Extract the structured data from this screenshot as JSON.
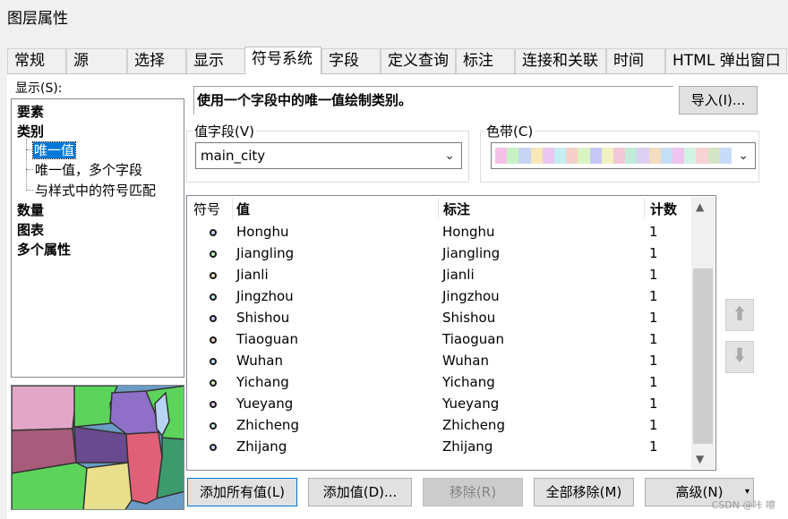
{
  "window": {
    "title": "图层属性"
  },
  "tabs": [
    {
      "label": "常规"
    },
    {
      "label": "源"
    },
    {
      "label": "选择"
    },
    {
      "label": "显示"
    },
    {
      "label": "符号系统"
    },
    {
      "label": "字段"
    },
    {
      "label": "定义查询"
    },
    {
      "label": "标注"
    },
    {
      "label": "连接和关联"
    },
    {
      "label": "时间"
    },
    {
      "label": "HTML 弹出窗口"
    }
  ],
  "show": {
    "label": "显示(S):",
    "tree": [
      {
        "label": "要素"
      },
      {
        "label": "类别"
      },
      {
        "label": "唯一值"
      },
      {
        "label": "唯一值，多个字段"
      },
      {
        "label": "与样式中的符号匹配"
      },
      {
        "label": "数量"
      },
      {
        "label": "图表"
      },
      {
        "label": "多个属性"
      }
    ]
  },
  "description": "使用一个字段中的唯一值绘制类别。",
  "import_button": "导入(I)...",
  "value_field": {
    "label": "值字段(V)",
    "value": "main_city"
  },
  "color_ramp": {
    "label": "色带(C)",
    "swatches": [
      "#f4c2e6",
      "#c6f2c4",
      "#c8d4f4",
      "#f6e6b8",
      "#e8c8f2",
      "#c4eef2",
      "#f4d0c8",
      "#d8f4c0",
      "#c8c8f6",
      "#f2f2c0",
      "#f2c8d8",
      "#c0ecd8",
      "#dcd0f4",
      "#f4dcc0",
      "#c4e0f4",
      "#f0c4f0",
      "#d0f4e4",
      "#f6d4d4",
      "#d4e4c4",
      "#c8dcf8"
    ]
  },
  "table": {
    "headers": {
      "symbol": "符号",
      "value": "值",
      "label": "标注",
      "count": "计数"
    },
    "rows": [
      {
        "value": "Honghu",
        "label": "Honghu",
        "count": "1",
        "color": "#c8d4f4"
      },
      {
        "value": "Jiangling",
        "label": "Jiangling",
        "count": "1",
        "color": "#c6f2c4"
      },
      {
        "value": "Jianli",
        "label": "Jianli",
        "count": "1",
        "color": "#f6e6b8"
      },
      {
        "value": "Jingzhou",
        "label": "Jingzhou",
        "count": "1",
        "color": "#c4eef2"
      },
      {
        "value": "Shishou",
        "label": "Shishou",
        "count": "1",
        "color": "#c8c8f6"
      },
      {
        "value": "Tiaoguan",
        "label": "Tiaoguan",
        "count": "1",
        "color": "#f4d0c8"
      },
      {
        "value": "Wuhan",
        "label": "Wuhan",
        "count": "1",
        "color": "#c4e0f4"
      },
      {
        "value": "Yichang",
        "label": "Yichang",
        "count": "1",
        "color": "#d8f4c0"
      },
      {
        "value": "Yueyang",
        "label": "Yueyang",
        "count": "1",
        "color": "#e8c8f2"
      },
      {
        "value": "Zhicheng",
        "label": "Zhicheng",
        "count": "1",
        "color": "#d0f4e4"
      },
      {
        "value": "Zhijang",
        "label": "Zhijang",
        "count": "1",
        "color": "#c8dcf8"
      }
    ]
  },
  "buttons": {
    "add_all": "添加所有值(L)",
    "add": "添加值(D)...",
    "remove": "移除(R)",
    "remove_all": "全部移除(M)",
    "advanced": "高级(N)"
  },
  "icons": {
    "move_up": "arrow-up-icon",
    "move_down": "arrow-down-icon"
  },
  "watermark": "CSDN @咔 嚓"
}
